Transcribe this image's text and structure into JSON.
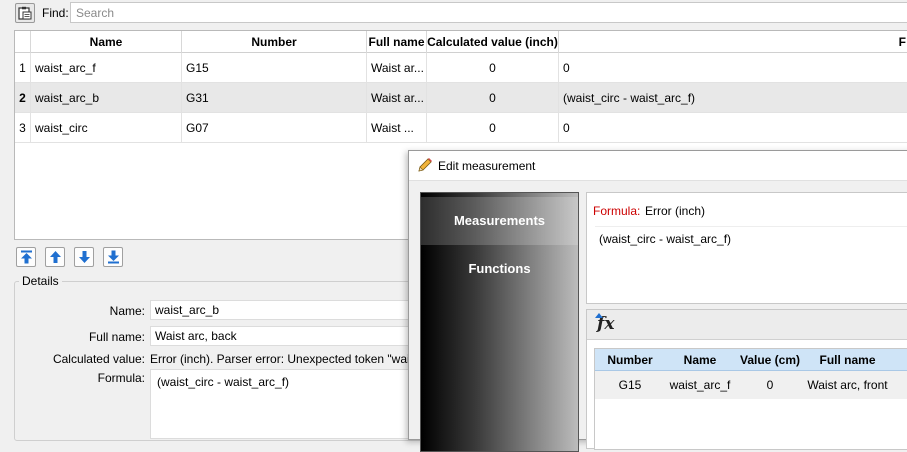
{
  "find": {
    "label": "Find:",
    "placeholder": "Search"
  },
  "table": {
    "headers": [
      "Name",
      "Number",
      "Full name",
      "Calculated value (inch)",
      "F"
    ],
    "rows": [
      {
        "index": "1",
        "name": "waist_arc_f",
        "number": "G15",
        "full_name": "Waist ar...",
        "value": "0",
        "formula": "0"
      },
      {
        "index": "2",
        "name": "waist_arc_b",
        "number": "G31",
        "full_name": "Waist ar...",
        "value": "0",
        "formula": "(waist_circ - waist_arc_f)"
      },
      {
        "index": "3",
        "name": "waist_circ",
        "number": "G07",
        "full_name": "Waist ...",
        "value": "0",
        "formula": "0"
      }
    ],
    "selected_index": 1
  },
  "move_buttons": [
    "move-top-icon",
    "move-up-icon",
    "move-down-icon",
    "move-bottom-icon"
  ],
  "details": {
    "title": "Details",
    "name_label": "Name:",
    "name_value": "waist_arc_b",
    "full_name_label": "Full name:",
    "full_name_value": "Waist arc, back",
    "calc_label": "Calculated value:",
    "calc_value": "Error (inch). Parser error: Unexpected token \"waist_c",
    "formula_label": "Formula:",
    "formula_value": "(waist_circ - waist_arc_f)"
  },
  "dialog": {
    "title": "Edit measurement",
    "sidebar": [
      "Measurements",
      "Functions"
    ],
    "formula_label": "Formula:",
    "formula_result": "Error (inch)",
    "formula_text": "(waist_circ - waist_arc_f)",
    "functions_table": {
      "headers": [
        "Number",
        "Name",
        "Value (cm)",
        "Full name"
      ],
      "rows": [
        {
          "number": "G15",
          "name": "waist_arc_f",
          "value": "0",
          "full_name": "Waist arc, front"
        }
      ]
    }
  },
  "colors": {
    "error_red": "#cc0000",
    "header_blue": "#cfe4f7",
    "move_arrow_blue": "#1f6fd0"
  }
}
